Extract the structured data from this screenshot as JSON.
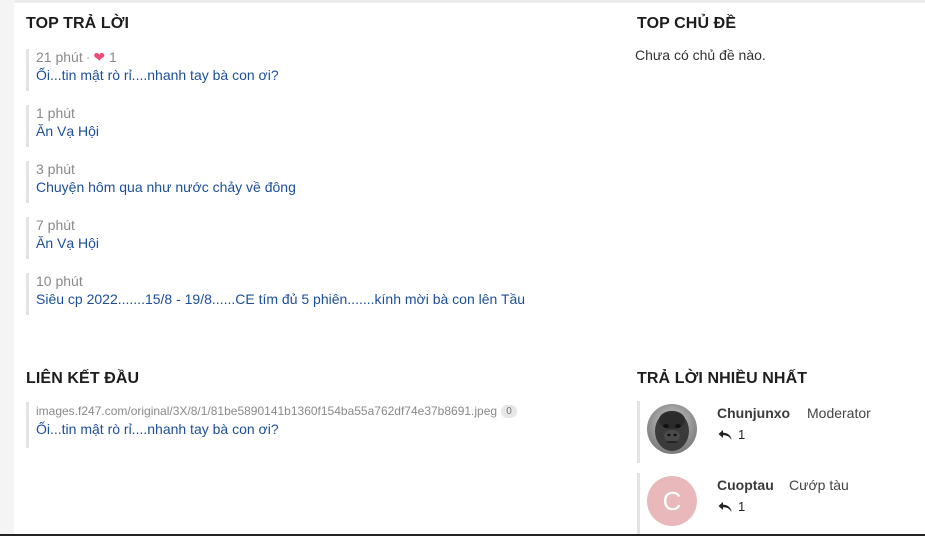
{
  "sections": {
    "top_replies": "TOP TRẢ LỜI",
    "top_topics": "TOP CHỦ ĐỀ",
    "top_links": "LIÊN KẾT ĐẦU",
    "most_replies": "TRẢ LỜI NHIỀU NHẤT"
  },
  "top_replies": [
    {
      "time": "21 phút",
      "likes": "1",
      "title": "Ối...tin mật rò rỉ....nhanh tay bà con ơi?"
    },
    {
      "time": "1 phút",
      "title": "Ăn Vạ Hội"
    },
    {
      "time": "3 phút",
      "title": "Chuyện hôm qua như nước chảy về đông"
    },
    {
      "time": "7 phút",
      "title": "Ăn Vạ Hội"
    },
    {
      "time": "10 phút",
      "title": "Siêu cp 2022.......15/8 - 19/8......CE tím đủ 5 phiên.......kính mời bà con lên Tầu"
    }
  ],
  "top_topics_empty": "Chưa có chủ đề nào.",
  "top_link": {
    "url": "images.f247.com/original/3X/8/1/81be5890141b1360f154ba55a762df74e37b8691.jpeg",
    "clicks": "0",
    "title": "Ối...tin mật rò rỉ....nhanh tay bà con ơi?"
  },
  "top_users": [
    {
      "name": "Chunjunxo",
      "role": "Moderator",
      "replies": "1",
      "avatar": "gorilla-photo"
    },
    {
      "name": "Cuoptau",
      "role": "Cướp tàu",
      "replies": "1",
      "avatar_letter": "C",
      "avatar_color": "#e8b8ba"
    }
  ],
  "colors": {
    "link": "#1d4e9b",
    "heart": "#ea4c7a",
    "muted": "#8a8a8a"
  }
}
